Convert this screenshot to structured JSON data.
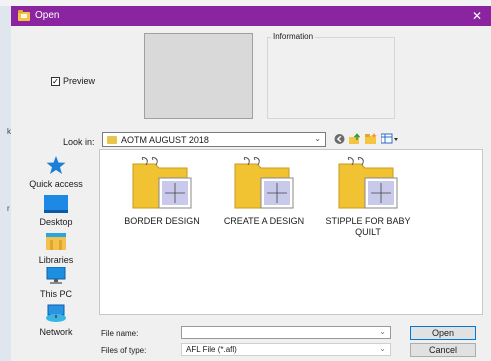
{
  "dialog": {
    "title": "Open",
    "close_glyph": "✕",
    "colors": {
      "titlebar": "#8b24a0",
      "body": "#f0f0f0"
    }
  },
  "background": {
    "edge_marks": [
      "k",
      "r"
    ]
  },
  "preview": {
    "label": "Preview",
    "checked": true,
    "check_glyph": "✓"
  },
  "information": {
    "label": "Information"
  },
  "look_in": {
    "label": "Look in:",
    "value": "AOTM AUGUST 2018",
    "toolbar_icons": [
      "back-icon",
      "up-folder-icon",
      "new-folder-icon",
      "view-menu-icon"
    ]
  },
  "places": [
    {
      "label": "Quick access",
      "icon": "quick-access-star-icon"
    },
    {
      "label": "Desktop",
      "icon": "desktop-icon"
    },
    {
      "label": "Libraries",
      "icon": "libraries-icon"
    },
    {
      "label": "This PC",
      "icon": "this-pc-icon"
    },
    {
      "label": "Network",
      "icon": "network-icon"
    }
  ],
  "files": [
    {
      "name": "BORDER DESIGN",
      "icon": "afl-folder-icon"
    },
    {
      "name": "CREATE A DESIGN",
      "icon": "afl-folder-icon"
    },
    {
      "name": "STIPPLE FOR BABY QUILT",
      "icon": "afl-folder-icon"
    }
  ],
  "file_name": {
    "label": "File name:",
    "value": ""
  },
  "file_type": {
    "label": "Files of type:",
    "value": "AFL File (*.afl)"
  },
  "buttons": {
    "open": "Open",
    "cancel": "Cancel"
  }
}
